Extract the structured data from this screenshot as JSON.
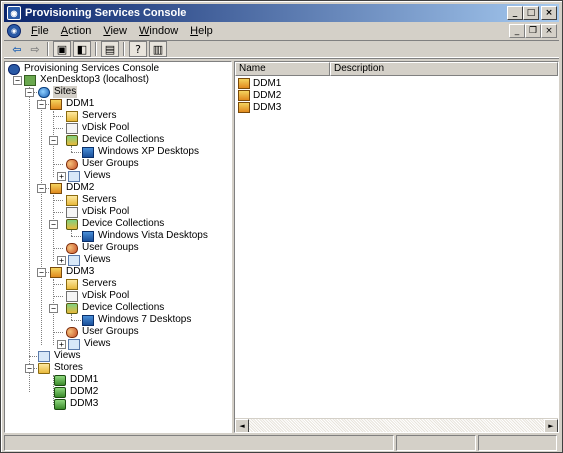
{
  "window": {
    "title": "Provisioning Services Console",
    "controls": {
      "minimize": "_",
      "maximize": "□",
      "close": "×"
    }
  },
  "menubar": {
    "items": [
      {
        "label": "File",
        "accel": "F"
      },
      {
        "label": "Action",
        "accel": "A"
      },
      {
        "label": "View",
        "accel": "V"
      },
      {
        "label": "Window",
        "accel": "W"
      },
      {
        "label": "Help",
        "accel": "H"
      }
    ],
    "child_controls": {
      "minimize": "_",
      "restore": "❐",
      "close": "×"
    }
  },
  "toolbar": {
    "buttons": [
      "back-arrow-icon",
      "forward-arrow-icon",
      "up-folder-icon",
      "show-hide-tree-icon",
      "export-list-icon",
      "help-icon",
      "properties-icon"
    ]
  },
  "tree": {
    "root": "Provisioning Services Console",
    "farm": "XenDesktop3 (localhost)",
    "sites_label": "Sites",
    "sites": [
      {
        "name": "DDM1",
        "servers": "Servers",
        "vdisk_pool": "vDisk Pool",
        "device_collections": "Device Collections",
        "collection": "Windows XP Desktops",
        "user_groups": "User Groups",
        "views": "Views"
      },
      {
        "name": "DDM2",
        "servers": "Servers",
        "vdisk_pool": "vDisk Pool",
        "device_collections": "Device Collections",
        "collection": "Windows Vista Desktops",
        "user_groups": "User Groups",
        "views": "Views"
      },
      {
        "name": "DDM3",
        "servers": "Servers",
        "vdisk_pool": "vDisk Pool",
        "device_collections": "Device Collections",
        "collection": "Windows 7 Desktops",
        "user_groups": "User Groups",
        "views": "Views"
      }
    ],
    "views_label": "Views",
    "stores_label": "Stores",
    "stores": [
      "DDM1",
      "DDM2",
      "DDM3"
    ]
  },
  "list": {
    "columns": [
      "Name",
      "Description"
    ],
    "rows": [
      {
        "name": "DDM1",
        "description": ""
      },
      {
        "name": "DDM2",
        "description": ""
      },
      {
        "name": "DDM3",
        "description": ""
      }
    ],
    "scroll": {
      "left": "◄",
      "right": "►"
    }
  }
}
